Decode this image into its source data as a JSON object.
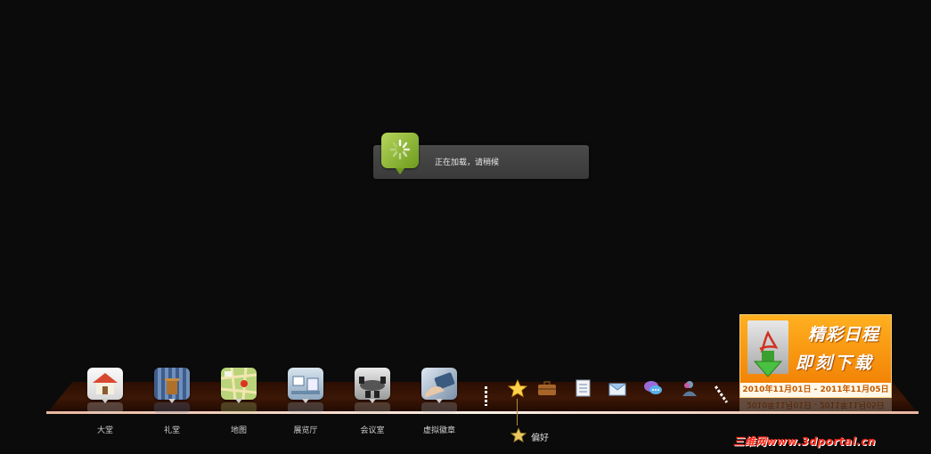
{
  "loading": {
    "text": "正在加载，请稍候"
  },
  "dock": {
    "items": [
      {
        "label": "大堂",
        "icon": "house-icon"
      },
      {
        "label": "礼堂",
        "icon": "auditorium-icon"
      },
      {
        "label": "地图",
        "icon": "map-icon"
      },
      {
        "label": "展览厅",
        "icon": "exhibition-hall-icon"
      },
      {
        "label": "会议室",
        "icon": "meeting-room-icon"
      },
      {
        "label": "虚拟徽章",
        "icon": "virtual-badge-icon"
      }
    ],
    "tools": [
      {
        "icon": "star-icon"
      },
      {
        "icon": "briefcase-icon"
      },
      {
        "icon": "notes-icon"
      },
      {
        "icon": "mail-icon"
      },
      {
        "icon": "chat-icon"
      },
      {
        "icon": "user-icon"
      }
    ],
    "favorites_label": "偏好"
  },
  "promo": {
    "line1": "精彩日程",
    "line2": "即刻下载",
    "dates": "2010年11月01日 - 2011年11月05日"
  },
  "watermark": "三维网www.3dportal.cn",
  "colors": {
    "background": "#0b0b0b",
    "dock_bar": "#3c1706",
    "promo_orange": "#f07a00",
    "spinner_green": "#8ab83a"
  }
}
